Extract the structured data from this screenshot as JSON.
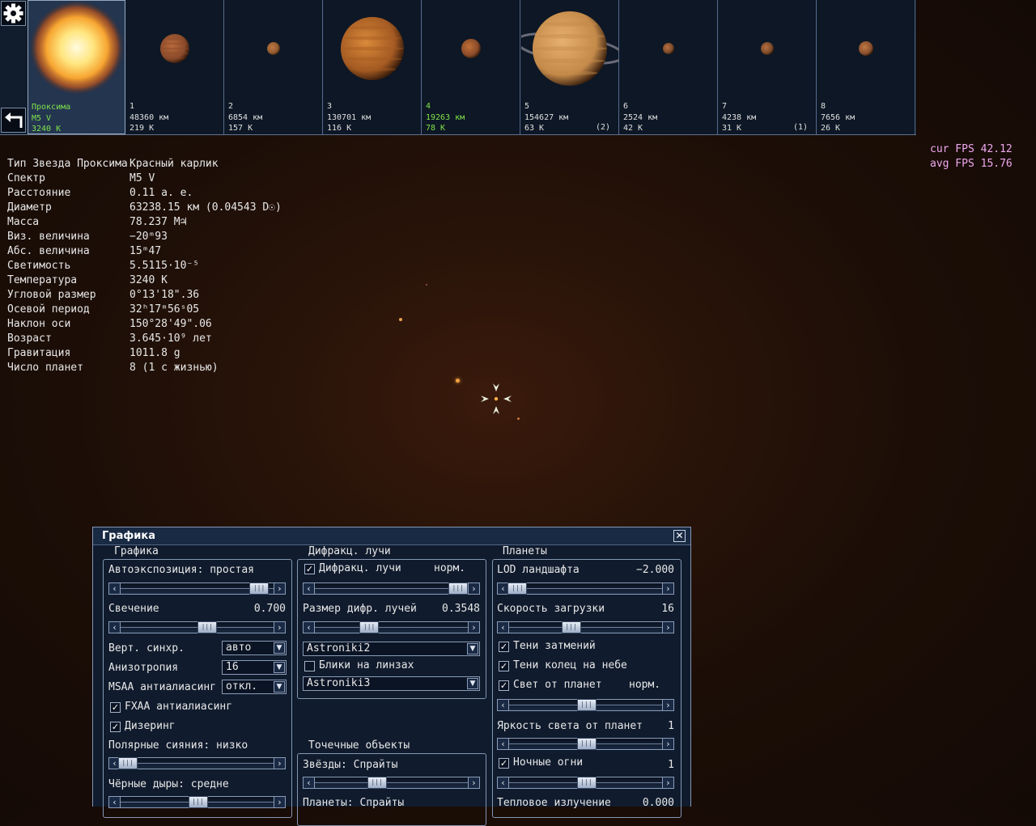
{
  "strip": {
    "star": {
      "name": "Проксима",
      "spectrum": "M5 V",
      "temp": "3240 K"
    },
    "planets": [
      {
        "num": "1",
        "dist": "48360 км",
        "temp": "219 K",
        "badge": ""
      },
      {
        "num": "2",
        "dist": "6854 км",
        "temp": "157 K",
        "badge": ""
      },
      {
        "num": "3",
        "dist": "130701 км",
        "temp": "116 K",
        "badge": ""
      },
      {
        "num": "4",
        "dist": "19263 км",
        "temp": "78 K",
        "badge": ""
      },
      {
        "num": "5",
        "dist": "154627 км",
        "temp": "63 K",
        "badge": "(2)"
      },
      {
        "num": "6",
        "dist": "2524 км",
        "temp": "42 K",
        "badge": ""
      },
      {
        "num": "7",
        "dist": "4238 км",
        "temp": "31 K",
        "badge": "(1)"
      },
      {
        "num": "8",
        "dist": "7656 км",
        "temp": "26 K",
        "badge": ""
      }
    ]
  },
  "info": {
    "title_label": "Звезда",
    "title_value": "Проксима",
    "rows": [
      {
        "label": "Тип",
        "value": "Красный карлик"
      },
      {
        "label": "Спектр",
        "value": "M5 V"
      },
      {
        "label": "Расстояние",
        "value": "0.11 а. е."
      },
      {
        "label": "Диаметр",
        "value": "63238.15 км (0.04543 D☉)"
      },
      {
        "label": "Масса",
        "value": "78.237 M♃"
      },
      {
        "label": "Виз. величина",
        "value": "−20ᵐ93"
      },
      {
        "label": "Абс. величина",
        "value": "15ᵐ47"
      },
      {
        "label": "Светимость",
        "value": "5.5115·10⁻⁵"
      },
      {
        "label": "Температура",
        "value": "3240 K"
      },
      {
        "label": "Угловой размер",
        "value": "0°13'18\".36"
      },
      {
        "label": "Осевой период",
        "value": "32ʰ17ᵐ56ˢ05"
      },
      {
        "label": "Наклон оси",
        "value": "150°28'49\".06"
      },
      {
        "label": "Возраст",
        "value": "3.645·10⁹ лет"
      },
      {
        "label": "Гравитация",
        "value": "1011.8 g"
      },
      {
        "label": "Число планет",
        "value": "8 (1 с жизнью)"
      }
    ]
  },
  "fps": {
    "cur": "cur FPS 42.12",
    "avg": "avg FPS 15.76"
  },
  "window": {
    "title": "Графика",
    "close": "✕",
    "g1": {
      "title": "Графика",
      "autoexp": "Автоэкспозиция: простая",
      "autoexp_pos": 0.9,
      "glow_label": "Свечение",
      "glow_value": "0.700",
      "glow_pos": 0.56,
      "vsync_label": "Верт. синхр.",
      "vsync_value": "авто",
      "aniso_label": "Анизотропия",
      "aniso_value": "16",
      "msaa_label": "MSAA антиалиасинг",
      "msaa_value": "откл.",
      "fxaa_label": "FXAA антиалиасинг",
      "fxaa": true,
      "dither_label": "Дизеринг",
      "dither": true,
      "aurora_label": "Полярные сияния: низко",
      "aurora_pos": 0.04,
      "bh_label": "Чёрные дыры: средне",
      "bh_pos": 0.5
    },
    "g2": {
      "title": "Дифракц. лучи",
      "diff_label": "Дифракц. лучи",
      "diff": true,
      "diff_mode": "норм.",
      "diff_pos": 0.93,
      "size_label": "Размер дифр. лучей",
      "size_value": "0.3548",
      "size_pos": 0.35,
      "dd1": "Astroniki2",
      "flares_label": "Блики на линзах",
      "flares": false,
      "dd2": "Astroniki3"
    },
    "g3": {
      "title": "Точечные объекты",
      "stars_label": "Звёзды: Спрайты",
      "stars_pos": 0.4,
      "planets_label": "Планеты: Спрайты"
    },
    "g4": {
      "title": "Планеты",
      "lod_label": "LOD ландшафта",
      "lod_value": "−2.000",
      "lod_pos": 0.05,
      "load_label": "Скорость загрузки",
      "load_value": "16",
      "load_pos": 0.4,
      "eclipse_label": "Тени затмений",
      "eclipse": true,
      "rings_label": "Тени колец на небе",
      "rings": true,
      "planetlight_label": "Свет от планет",
      "planetlight": true,
      "planetlight_mode": "норм.",
      "planetlight_pos": 0.5,
      "brightness_label": "Яркость света от планет",
      "brightness_value": "1",
      "brightness_pos": 0.5,
      "night_label": "Ночные огни",
      "night": true,
      "night_value": "1",
      "night_pos": 0.5,
      "thermal_label": "Тепловое излучение",
      "thermal_value": "0.000"
    }
  }
}
